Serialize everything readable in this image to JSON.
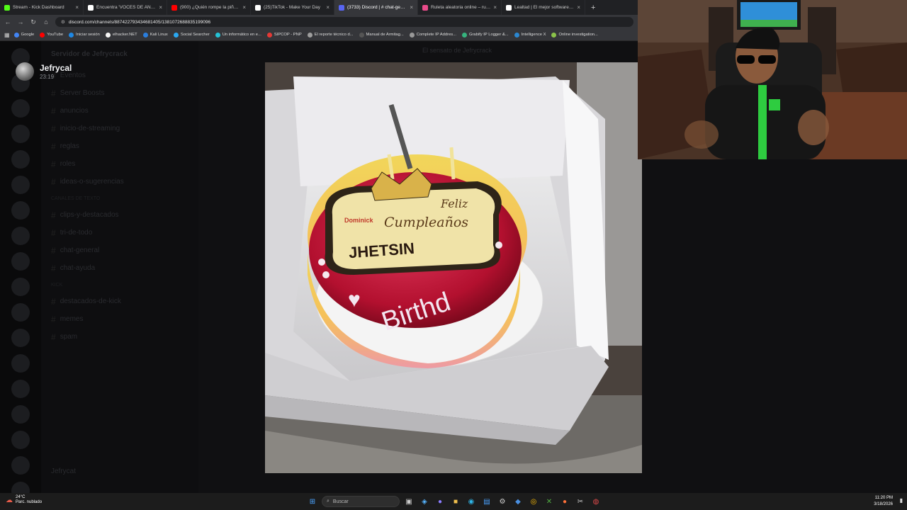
{
  "browser": {
    "tabs": [
      {
        "label": "Stream - Kick Dashboard",
        "color": "#53fc18",
        "active": false
      },
      {
        "label": "Encuentra 'VOCES DE ANIMME'",
        "color": "#ffffff",
        "active": false
      },
      {
        "label": "(900) ¿Quién rompe la piñata?",
        "color": "#ff0000",
        "active": false
      },
      {
        "label": "(25)TikTok - Make Your Day",
        "color": "#ffffff",
        "active": false
      },
      {
        "label": "(3733) Discord | # chat-general",
        "color": "#5865f2",
        "active": true
      },
      {
        "label": "Ruleta aleatoria online – ruleta",
        "color": "#e94b8a",
        "active": false
      },
      {
        "label": "Lealtad | El mejor software para",
        "color": "#ffffff",
        "active": false
      }
    ],
    "url": "discord.com/channels/887422793434681405/1381072688835199096",
    "bookmarks": [
      {
        "label": "Google",
        "color": "#4285f4"
      },
      {
        "label": "YouTube",
        "color": "#ff0000"
      },
      {
        "label": "Iniciar sesión",
        "color": "#1e88e5"
      },
      {
        "label": "elhacker.NET",
        "color": "#f5f5f5"
      },
      {
        "label": "Kali Linux",
        "color": "#2a7ddc"
      },
      {
        "label": "Social Searcher",
        "color": "#2aa8f2"
      },
      {
        "label": "Un informático en e...",
        "color": "#25c2d6"
      },
      {
        "label": "SIPCOP - PNP",
        "color": "#e53935"
      },
      {
        "label": "El reporte técnico d...",
        "color": "#9e9e9e"
      },
      {
        "label": "Manual de Armitag...",
        "color": "#555555"
      },
      {
        "label": "Complete IP Addres...",
        "color": "#999999"
      },
      {
        "label": "Grabify IP Logger &...",
        "color": "#36b37e"
      },
      {
        "label": "Intelligence X",
        "color": "#2b87d1"
      },
      {
        "label": "Online investigation...",
        "color": "#8bc34a"
      }
    ]
  },
  "discord": {
    "header_title": "El sensato de Jefrycrack",
    "server_name": "Servidor de Jefrycrack",
    "channels": [
      {
        "label": "Eventos",
        "cat": false
      },
      {
        "label": "Server Boosts",
        "cat": false
      },
      {
        "label": "anuncios",
        "cat": false
      },
      {
        "label": "inicio-de-streaming",
        "cat": false
      },
      {
        "label": "reglas",
        "cat": false
      },
      {
        "label": "roles",
        "cat": false
      },
      {
        "label": "ideas-o-sugerencias",
        "cat": false
      },
      {
        "label": "Canales de texto",
        "cat": true
      },
      {
        "label": "clips-y-destacados",
        "cat": false
      },
      {
        "label": "tri-de-todo",
        "cat": false
      },
      {
        "label": "chat-general",
        "cat": false
      },
      {
        "label": "chat-ayuda",
        "cat": false
      },
      {
        "label": "Kick",
        "cat": true
      },
      {
        "label": "destacados-de-kick",
        "cat": false
      },
      {
        "label": "memes",
        "cat": false
      },
      {
        "label": "spam",
        "cat": false
      }
    ],
    "footer_user": "Jefrycat"
  },
  "viewer": {
    "username": "Jefrycal",
    "time": "23:19",
    "photo_text": {
      "plaque_line1": "Feliz",
      "plaque_line2": "Cumpleaños",
      "plaque_brand": "Dominick",
      "plaque_name": "JHETSIN",
      "cake_text": "Birthd"
    }
  },
  "taskbar": {
    "weather_temp": "24°C",
    "weather_desc": "Parc. nublado",
    "search_placeholder": "Buscar",
    "time": "11:20 PM",
    "date": "3/18/2026"
  }
}
